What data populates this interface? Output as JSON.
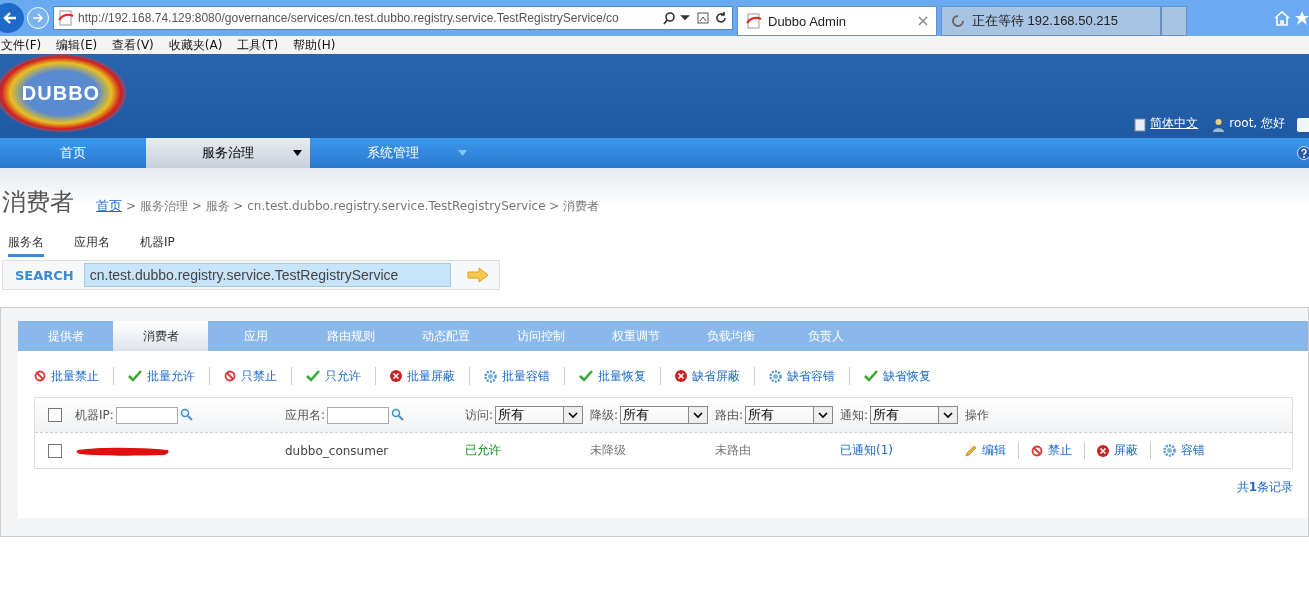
{
  "browser": {
    "address": "http://192.168.74.129:8080/governance/services/cn.test.dubbo.registry.service.TestRegistryService/co",
    "tabs": [
      {
        "title": "Dubbo Admin",
        "selected": true,
        "kind": "page"
      },
      {
        "title": "正在等待 192.168.50.215",
        "selected": false,
        "kind": "loading"
      }
    ],
    "menu": [
      "文件(F)",
      "编辑(E)",
      "查看(V)",
      "收藏夹(A)",
      "工具(T)",
      "帮助(H)"
    ]
  },
  "header": {
    "logo": "DUBBO",
    "language": "简体中文",
    "user": "root, 您好"
  },
  "nav": [
    {
      "label": "首页",
      "selected": false,
      "dropdown": false
    },
    {
      "label": "服务治理",
      "selected": true,
      "dropdown": true
    },
    {
      "label": "系统管理",
      "selected": false,
      "dropdown": true
    }
  ],
  "page": {
    "title": "消费者",
    "breadcrumb_link": "首页",
    "breadcrumb_trail": "> 服务治理 > 服务 > cn.test.dubbo.registry.service.TestRegistryService > 消费者"
  },
  "search": {
    "tabs": [
      {
        "label": "服务名",
        "selected": true
      },
      {
        "label": "应用名",
        "selected": false
      },
      {
        "label": "机器IP",
        "selected": false
      }
    ],
    "label": "SEARCH",
    "value": "cn.test.dubbo.registry.service.TestRegistryService"
  },
  "panel_tabs": [
    {
      "label": "提供者",
      "selected": false
    },
    {
      "label": "消费者",
      "selected": true
    },
    {
      "label": "应用",
      "selected": false
    },
    {
      "label": "路由规则",
      "selected": false
    },
    {
      "label": "动态配置",
      "selected": false
    },
    {
      "label": "访问控制",
      "selected": false
    },
    {
      "label": "权重调节",
      "selected": false
    },
    {
      "label": "负载均衡",
      "selected": false
    },
    {
      "label": "负责人",
      "selected": false
    }
  ],
  "actions": [
    {
      "label": "批量禁止",
      "kind": "ban"
    },
    {
      "label": "批量允许",
      "kind": "check"
    },
    {
      "label": "只禁止",
      "kind": "ban"
    },
    {
      "label": "只允许",
      "kind": "check"
    },
    {
      "label": "批量屏蔽",
      "kind": "block"
    },
    {
      "label": "批量容错",
      "kind": "gear"
    },
    {
      "label": "批量恢复",
      "kind": "check"
    },
    {
      "label": "缺省屏蔽",
      "kind": "block"
    },
    {
      "label": "缺省容错",
      "kind": "gear"
    },
    {
      "label": "缺省恢复",
      "kind": "check"
    }
  ],
  "table": {
    "select_all": {
      "checked": false
    },
    "filters": [
      {
        "label": "机器IP:",
        "kind": "text"
      },
      {
        "label": "应用名:",
        "kind": "text"
      },
      {
        "label": "访问:",
        "kind": "select",
        "value": "所有"
      },
      {
        "label": "降级:",
        "kind": "select",
        "value": "所有"
      },
      {
        "label": "路由:",
        "kind": "select",
        "value": "所有"
      },
      {
        "label": "通知:",
        "kind": "select",
        "value": "所有"
      },
      {
        "label": "操作",
        "kind": "heading"
      }
    ],
    "rows": [
      {
        "checked": false,
        "cells": [
          {
            "kind": "redacted"
          },
          {
            "kind": "text",
            "text": "dubbo_consumer"
          },
          {
            "kind": "allowed",
            "text": "已允许"
          },
          {
            "kind": "muted",
            "text": "未降级"
          },
          {
            "kind": "muted",
            "text": "未路由"
          },
          {
            "kind": "link",
            "text": "已通知(1)"
          }
        ],
        "ops": [
          {
            "label": "编辑",
            "kind": "pencil"
          },
          {
            "label": "禁止",
            "kind": "ban"
          },
          {
            "label": "屏蔽",
            "kind": "block"
          },
          {
            "label": "容错",
            "kind": "gear"
          }
        ]
      }
    ],
    "total": "共**1**条记录"
  }
}
